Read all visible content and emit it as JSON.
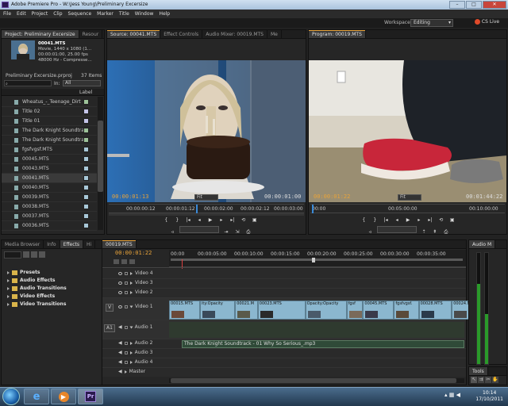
{
  "window": {
    "title": "Adobe Premiere Pro - W:\\Jess Young\\Preliminary Excersize"
  },
  "window_buttons": {
    "minimize": "–",
    "maximize": "□",
    "close": "✕"
  },
  "menu": [
    "File",
    "Edit",
    "Project",
    "Clip",
    "Sequence",
    "Marker",
    "Title",
    "Window",
    "Help"
  ],
  "workspace": {
    "label": "Workspace:",
    "value": "Editing",
    "cslive": "CS Live"
  },
  "project": {
    "tabs": [
      "Project: Preliminary Excersize",
      "Resour"
    ],
    "clip_name": "00041.MTS",
    "clip_info": [
      "Movie, 1440 x 1080 (1...",
      "00:00:01:00, 25.00 fps",
      "48000 Hz - Compresse..."
    ],
    "project_file": "Preliminary Excersize.prproj",
    "item_count": "37 Items",
    "in_label": "In:",
    "in_value": "All",
    "col_label": "Label",
    "items": [
      {
        "name": "Wheatus_-_Teenage_Dirt",
        "color": "#9dc39a"
      },
      {
        "name": "Title 02",
        "color": "#c4c4e8"
      },
      {
        "name": "Title 01",
        "color": "#c4c4e8"
      },
      {
        "name": "The Dark Knight Soundtrack",
        "color": "#9dc39a"
      },
      {
        "name": "The Dark Knight Soundtra",
        "color": "#9dc39a"
      },
      {
        "name": "fgsfvgsf.MTS",
        "color": "#a8c8d8"
      },
      {
        "name": "00045.MTS",
        "color": "#a8c8d8"
      },
      {
        "name": "00043.MTS",
        "color": "#a8c8d8"
      },
      {
        "name": "00041.MTS",
        "color": "#a8c8d8"
      },
      {
        "name": "00040.MTS",
        "color": "#a8c8d8"
      },
      {
        "name": "00039.MTS",
        "color": "#a8c8d8"
      },
      {
        "name": "00038.MTS",
        "color": "#a8c8d8"
      },
      {
        "name": "00037.MTS",
        "color": "#a8c8d8"
      },
      {
        "name": "00036.MTS",
        "color": "#a8c8d8"
      }
    ]
  },
  "source": {
    "tabs": [
      "Source: 00041.MTS",
      "Effect Controls",
      "Audio Mixer: 00019.MTS",
      "Me"
    ],
    "timecode": "00:00:01:13",
    "fit": "Fit",
    "duration": "00:00:01:00",
    "ruler": [
      "00:00:00:12",
      "00:00:01:12",
      "00:00:02:00",
      "00:00:02:12",
      "00:00:03:00"
    ]
  },
  "program": {
    "tabs": [
      "Program: 00019.MTS"
    ],
    "timecode": "00:00:01:22",
    "fit": "Fit",
    "duration": "00:01:44:22",
    "ruler": [
      "00:00",
      "00:05:00:00",
      "00:10:00:00"
    ]
  },
  "effects": {
    "tabs": [
      "Media Browser",
      "Info",
      "Effects",
      "Hi"
    ],
    "items": [
      "Presets",
      "Audio Effects",
      "Audio Transitions",
      "Video Effects",
      "Video Transitions"
    ]
  },
  "timeline": {
    "tabs": [
      "00019.MTS"
    ],
    "timecode": "00:00:01:22",
    "ruler": [
      "00:00",
      "00:00:05:00",
      "00:00:10:00",
      "00:00:15:00",
      "00:00:20:00",
      "00:00:25:00",
      "00:00:30:00",
      "00:00:35:00"
    ],
    "video_tracks": [
      "Video 4",
      "Video 3",
      "Video 2",
      "Video 1"
    ],
    "audio_tracks": [
      "Audio 1",
      "Audio 2",
      "Audio 3",
      "Audio 4",
      "Master"
    ],
    "target_v": "V",
    "target_a": "A1",
    "video1_clips": [
      "00015.MTS",
      "ity:Opacity",
      "00021.M",
      "00023.MTS",
      "Opacity:Opacity",
      "fgsf",
      "00045.MTS",
      "fgsfvgsf.",
      "00028.MTS",
      "00024.MTS"
    ],
    "audio2_clip": "The Dark Knight Soundtrack - 01 Why So Serious_.mp3"
  },
  "audio_meter": {
    "tab": "Audio M",
    "levels": [
      0.72,
      0.45
    ]
  },
  "tools": {
    "tab": "Tools"
  },
  "taskbar": {
    "time": "10:14",
    "date": "17/10/2011",
    "app_label": "Pr"
  }
}
